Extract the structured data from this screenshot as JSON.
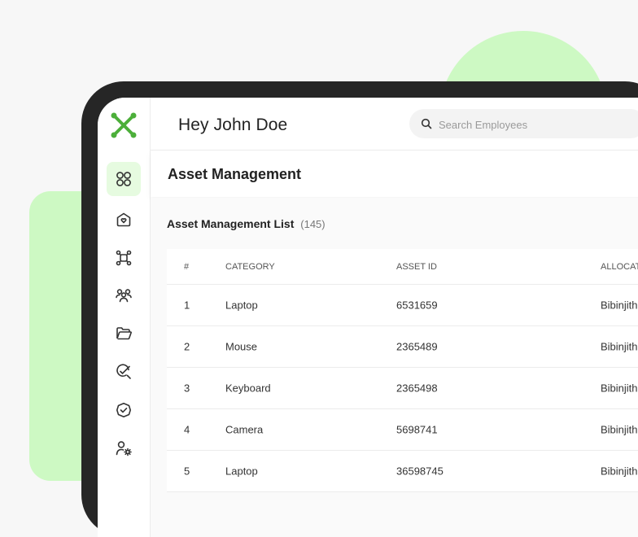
{
  "header": {
    "greeting": "Hey John Doe",
    "search_placeholder": "Search Employees"
  },
  "sidebar": {
    "items": [
      {
        "icon": "grid-icon",
        "active": true
      },
      {
        "icon": "home-heart-icon",
        "active": false
      },
      {
        "icon": "network-icon",
        "active": false
      },
      {
        "icon": "users-icon",
        "active": false
      },
      {
        "icon": "folder-open-icon",
        "active": false
      },
      {
        "icon": "search-check-icon",
        "active": false
      },
      {
        "icon": "badge-check-icon",
        "active": false
      },
      {
        "icon": "user-settings-icon",
        "active": false
      }
    ]
  },
  "page": {
    "title": "Asset Management",
    "list_title": "Asset Management List",
    "list_count": "(145)"
  },
  "table": {
    "columns": [
      "#",
      "CATEGORY",
      "ASSET ID",
      "ALLOCAT"
    ],
    "rows": [
      [
        "1",
        "Laptop",
        "6531659",
        "Bibinjith"
      ],
      [
        "2",
        "Mouse",
        "2365489",
        "Bibinjith"
      ],
      [
        "3",
        "Keyboard",
        "2365498",
        "Bibinjith"
      ],
      [
        "4",
        "Camera",
        "5698741",
        "Bibinjith"
      ],
      [
        "5",
        "Laptop",
        "36598745",
        "Bibinjith"
      ]
    ]
  },
  "colors": {
    "accent": "#4caf3a",
    "accent_light": "#cdf9c3",
    "device_frame": "#262626"
  }
}
